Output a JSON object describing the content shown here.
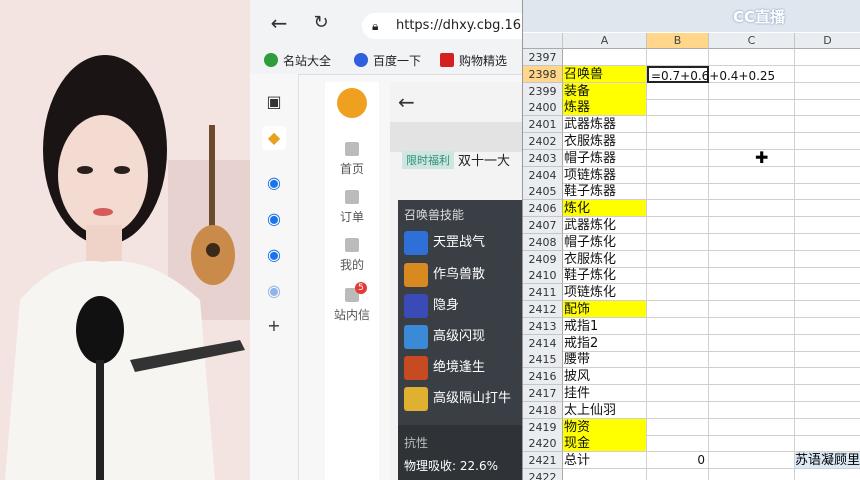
{
  "browser": {
    "url": "https://dhxy.cbg.16",
    "bookmarks": [
      {
        "label": "名站大全",
        "color": "#2e9d3a"
      },
      {
        "label": "百度一下",
        "color": "#3060e0"
      },
      {
        "label": "购物精选",
        "color": "#d62020"
      }
    ],
    "nav": [
      {
        "label": "首页"
      },
      {
        "label": "订单"
      },
      {
        "label": "我的"
      },
      {
        "label": "站内信",
        "badge": "5"
      }
    ],
    "promo_tag": "限时福利",
    "promo_text": "双十一大",
    "skills_title": "召唤兽技能",
    "skills": [
      {
        "name": "天罡战气",
        "color": "#2f6fd8"
      },
      {
        "name": "作鸟兽散",
        "color": "#d88a20"
      },
      {
        "name": "隐身",
        "color": "#3a4bb8"
      },
      {
        "name": "高级闪现",
        "color": "#3b8ad8"
      },
      {
        "name": "绝境逢生",
        "color": "#c84a20"
      },
      {
        "name": "高级隔山打牛",
        "color": "#e0b030"
      }
    ],
    "resist_title": "抗性",
    "resist_line": "物理吸收: 22.6%"
  },
  "sheet": {
    "columns": [
      "A",
      "B",
      "C",
      "D"
    ],
    "logo_text": "CC直播",
    "rows": [
      {
        "n": "2397",
        "a": "",
        "b": "",
        "d": ""
      },
      {
        "n": "2398",
        "a": "召唤兽",
        "b": "=0.7+0.6+0.4+0.25",
        "d": "",
        "y": true
      },
      {
        "n": "2399",
        "a": "装备",
        "b": "",
        "d": "",
        "y": true
      },
      {
        "n": "2400",
        "a": "炼器",
        "b": "",
        "d": "",
        "y": true
      },
      {
        "n": "2401",
        "a": "武器炼器",
        "b": "",
        "d": ""
      },
      {
        "n": "2402",
        "a": "衣服炼器",
        "b": "",
        "d": ""
      },
      {
        "n": "2403",
        "a": "帽子炼器",
        "b": "",
        "d": ""
      },
      {
        "n": "2404",
        "a": "项链炼器",
        "b": "",
        "d": ""
      },
      {
        "n": "2405",
        "a": "鞋子炼器",
        "b": "",
        "d": ""
      },
      {
        "n": "2406",
        "a": "炼化",
        "b": "",
        "d": "",
        "y": true
      },
      {
        "n": "2407",
        "a": "武器炼化",
        "b": "",
        "d": ""
      },
      {
        "n": "2408",
        "a": "帽子炼化",
        "b": "",
        "d": ""
      },
      {
        "n": "2409",
        "a": "衣服炼化",
        "b": "",
        "d": ""
      },
      {
        "n": "2410",
        "a": "鞋子炼化",
        "b": "",
        "d": ""
      },
      {
        "n": "2411",
        "a": "项链炼化",
        "b": "",
        "d": ""
      },
      {
        "n": "2412",
        "a": "配饰",
        "b": "",
        "d": "",
        "y": true
      },
      {
        "n": "2413",
        "a": "戒指1",
        "b": "",
        "d": ""
      },
      {
        "n": "2414",
        "a": "戒指2",
        "b": "",
        "d": ""
      },
      {
        "n": "2415",
        "a": "腰带",
        "b": "",
        "d": ""
      },
      {
        "n": "2416",
        "a": "披风",
        "b": "",
        "d": ""
      },
      {
        "n": "2417",
        "a": "挂件",
        "b": "",
        "d": ""
      },
      {
        "n": "2418",
        "a": "太上仙羽",
        "b": "",
        "d": ""
      },
      {
        "n": "2419",
        "a": "物资",
        "b": "",
        "d": "",
        "y": true
      },
      {
        "n": "2420",
        "a": "现金",
        "b": "",
        "d": "",
        "y": true
      },
      {
        "n": "2421",
        "a": "总计",
        "b": "0",
        "d": "苏语凝顾里",
        "total": true
      },
      {
        "n": "2422",
        "a": "",
        "b": "",
        "d": ""
      }
    ]
  }
}
